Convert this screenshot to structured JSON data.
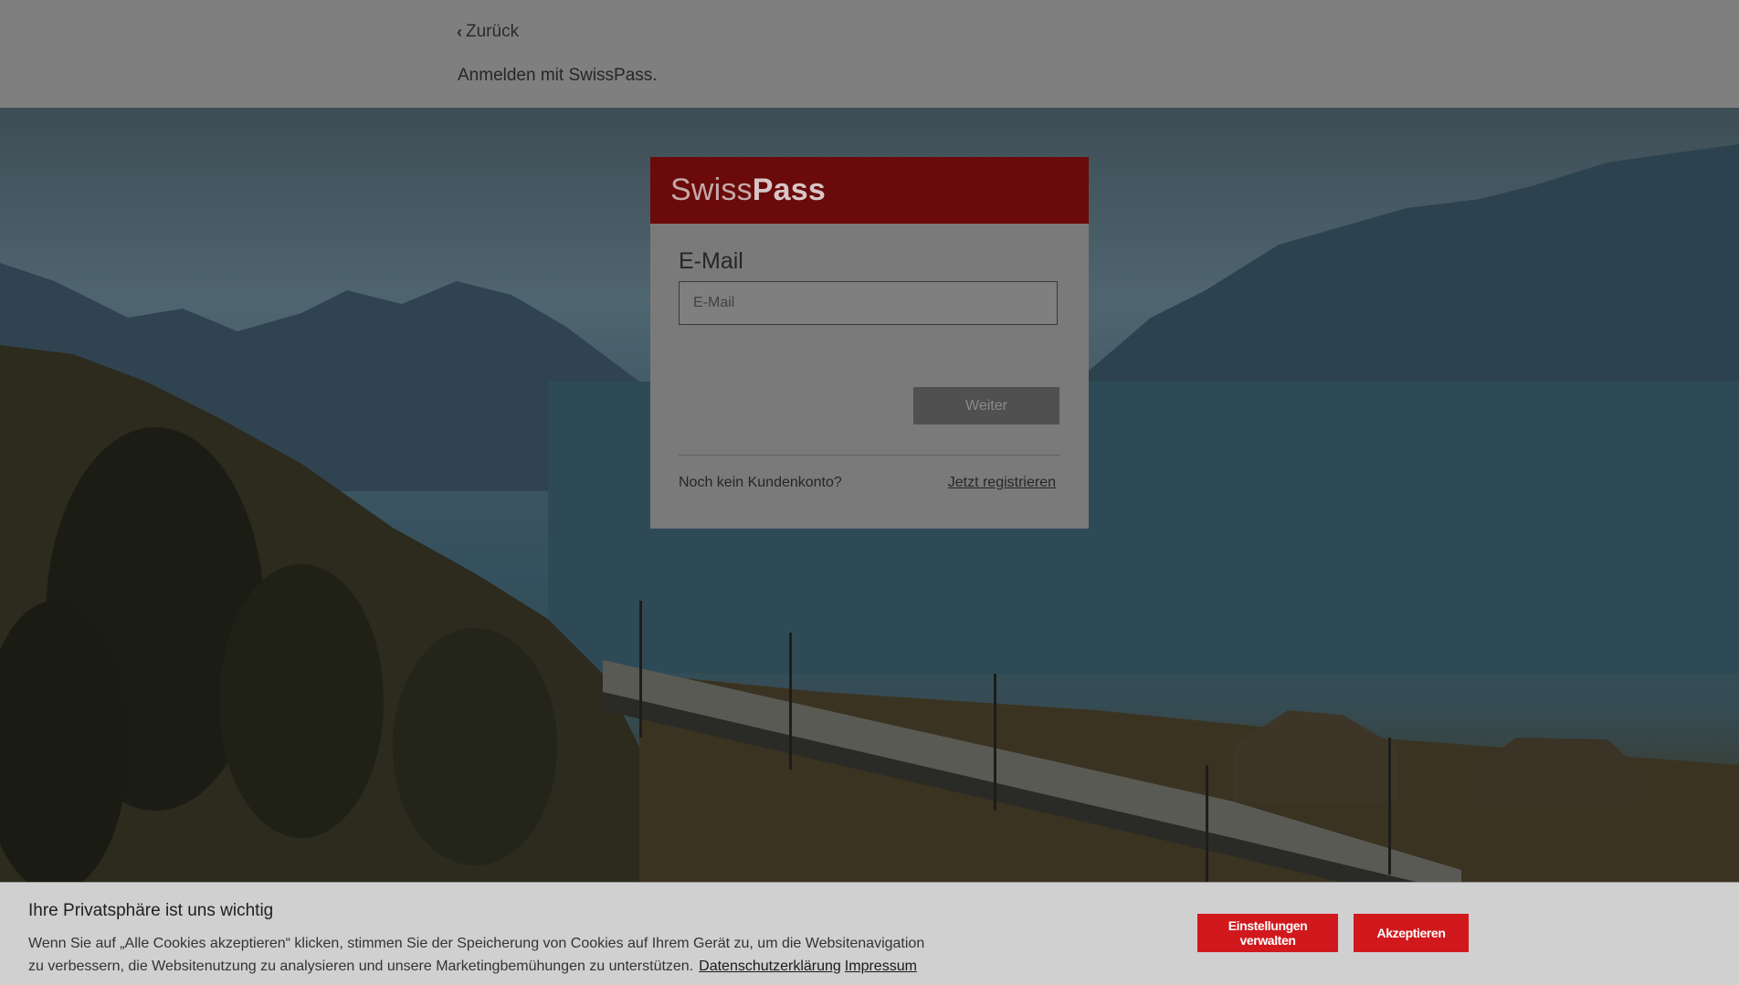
{
  "header": {
    "back_label": "Zurück",
    "subtitle": "Anmelden mit SwissPass."
  },
  "login": {
    "logo_light": "Swiss",
    "logo_bold": "Pass",
    "email_label": "E-Mail",
    "email_placeholder": "E-Mail",
    "email_value": "",
    "submit_label": "Weiter",
    "no_account_text": "Noch kein Kundenkonto?",
    "register_link": "Jetzt registrieren"
  },
  "cookie_banner": {
    "title": "Ihre Privatsphäre ist uns wichtig",
    "text": "Wenn Sie auf „Alle Cookies akzeptieren“ klicken, stimmen Sie der Speicherung von Cookies auf Ihrem Gerät zu, um die Websitenavigation zu verbessern, die Websitenutzung zu analysieren und unsere Marketingbemühungen zu unterstützen.",
    "privacy_link": "Datenschutzerklärung",
    "imprint_link": "Impressum",
    "settings_button": "Einstellungen verwalten",
    "accept_button": "Akzeptieren"
  },
  "colors": {
    "brand_red": "#d1181d",
    "header_red_dimmed": "#6b0a0b",
    "overlay_gray": "#7f7f7f"
  }
}
